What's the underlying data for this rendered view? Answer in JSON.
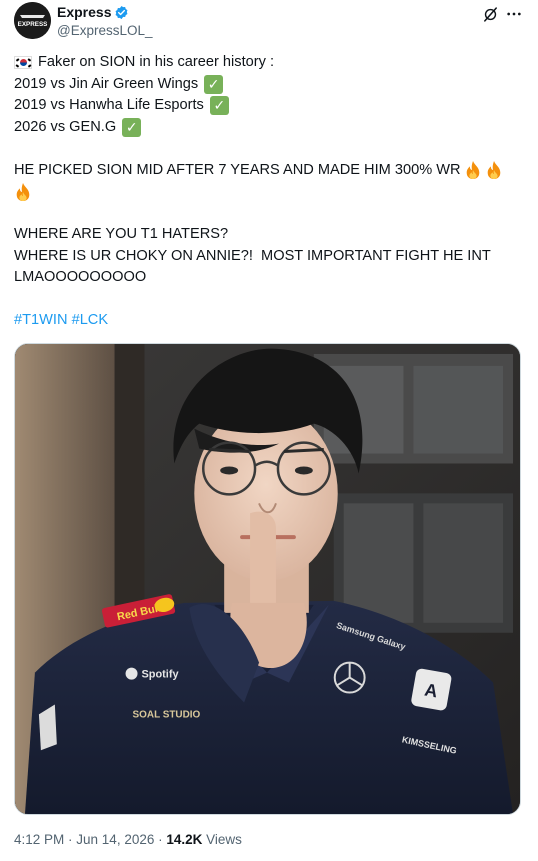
{
  "author": {
    "display_name": "Express",
    "handle": "@ExpressLOL_",
    "avatar_text": "EXPRESS",
    "verified_icon": "verified-badge-icon"
  },
  "header_actions": {
    "grok_icon": "grok-icon",
    "more_icon": "more-icon"
  },
  "tweet": {
    "line1": "Faker on SION in his career history :",
    "line2": "2019 vs Jin Air Green Wings",
    "line3": "2019 vs Hanwha Life Esports",
    "line4": "2026 vs GEN.G",
    "line5": "HE PICKED SION MID AFTER 7 YEARS AND MADE HIM 300% WR",
    "line6": "WHERE ARE YOU T1 HATERS?",
    "line7": "WHERE IS UR CHOKY ON ANNIE?!  MOST IMPORTANT FIGHT HE INT",
    "line8": "LMAOOOOOOOOO",
    "hashtag1": "#T1WIN",
    "hashtag2": "#LCK"
  },
  "media": {
    "jacket_logos": [
      "Red Bull",
      "Spotify",
      "SOAL STUDIO",
      "Samsung Galaxy",
      "KIMSSELING"
    ]
  },
  "meta": {
    "time": "4:12 PM",
    "separator": " · ",
    "date": "Jun 14, 2026",
    "views_count": "14.2K",
    "views_label": " Views"
  },
  "colors": {
    "text": "#0f1419",
    "secondary": "#536471",
    "link": "#1d9bf0",
    "check": "#78b159"
  }
}
